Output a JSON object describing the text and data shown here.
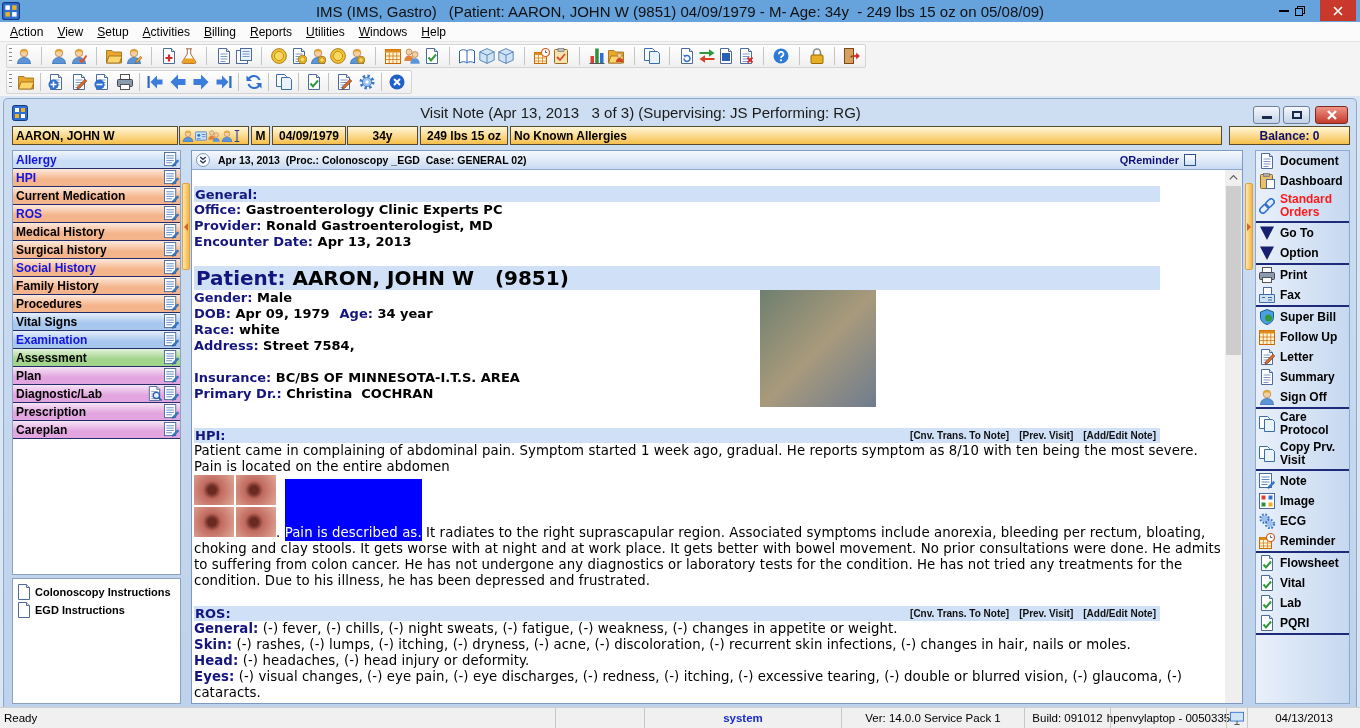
{
  "app": {
    "title": "IMS (IMS, Gastro)",
    "patient_summary": "(Patient: AARON, JOHN W (9851) 04/09/1979 - M- Age: 34y  - 249 lbs 15 oz on 05/08/09)"
  },
  "menu": [
    "Action",
    "View",
    "Setup",
    "Activities",
    "Billing",
    "Reports",
    "Utilities",
    "Windows",
    "Help"
  ],
  "visit_note": {
    "title": "Visit Note (Apr 13, 2013   3 of 3) (Supervising: JS Performing: RG)"
  },
  "patient_bar": {
    "name": "AARON, JOHN W",
    "sex": "M",
    "dob": "04/09/1979",
    "age": "34y",
    "weight": "249 lbs 15 oz",
    "allergies": "No Known Allergies",
    "balance": "Balance: 0"
  },
  "sidebar": {
    "items": [
      {
        "label": "Allergy",
        "kind": "section",
        "color": "#c9ddf6",
        "has_data": true
      },
      {
        "label": "HPI",
        "kind": "section",
        "color": "#f5b58c",
        "has_data": true
      },
      {
        "label": "Current Medication",
        "kind": "section",
        "color": "#f5b58c",
        "has_data": false
      },
      {
        "label": "ROS",
        "kind": "section",
        "color": "#f5b58c",
        "has_data": true
      },
      {
        "label": "Medical History",
        "kind": "section",
        "color": "#f5b58c",
        "has_data": false
      },
      {
        "label": "Surgical history",
        "kind": "section",
        "color": "#f5b58c",
        "has_data": false
      },
      {
        "label": "Social History",
        "kind": "section",
        "color": "#f5b58c",
        "has_data": true
      },
      {
        "label": "Family History",
        "kind": "section",
        "color": "#f5b58c",
        "has_data": false
      },
      {
        "label": "Procedures",
        "kind": "section",
        "color": "#f5b58c",
        "has_data": false
      },
      {
        "label": "Vital Signs",
        "kind": "section",
        "color": "#a8c7ef",
        "has_data": false
      },
      {
        "label": "Examination",
        "kind": "section",
        "color": "#a8c7ef",
        "has_data": true
      },
      {
        "label": "Assessment",
        "kind": "section",
        "color": "#a3d48c",
        "has_data": false
      },
      {
        "label": "Plan",
        "kind": "section",
        "color": "#e2a5df",
        "has_data": false
      },
      {
        "label": "Diagnostic/Lab",
        "kind": "lab",
        "color": "#e2a5df",
        "has_data": false
      },
      {
        "label": "Prescription",
        "kind": "section",
        "color": "#e2a5df",
        "has_data": false
      },
      {
        "label": "Careplan",
        "kind": "section",
        "color": "#e2a5df",
        "has_data": false
      }
    ]
  },
  "documents": [
    "Colonoscopy Instructions",
    "EGD Instructions"
  ],
  "note": {
    "header": {
      "title": "Apr 13, 2013  (Proc.: Colonoscopy _EGD  Case: GENERAL 02)",
      "qreminder": {
        "label": "QReminder",
        "checked": false
      }
    },
    "general": {
      "heading": "General:",
      "fields": [
        {
          "label": "Office:",
          "value": "Gastroenterology Clinic Experts PC"
        },
        {
          "label": "Provider:",
          "value": "Ronald Gastroenterologist, MD"
        },
        {
          "label": "Encounter Date:",
          "value": "Apr 13, 2013"
        }
      ]
    },
    "patient": {
      "label": "Patient:",
      "name": "AARON, JOHN W   (9851)",
      "demographics": [
        [
          {
            "label": "Gender:",
            "value": "Male"
          }
        ],
        [
          {
            "label": "DOB:",
            "value": "Apr 09, 1979"
          },
          {
            "label": "Age:",
            "value": "34 year"
          }
        ],
        [
          {
            "label": "Race:",
            "value": "white"
          }
        ],
        [
          {
            "label": "Address:",
            "value": "Street 7584,"
          }
        ]
      ],
      "coverage": [
        [
          {
            "label": "Insurance:",
            "value": "BC/BS OF MINNESOTA-I.T.S. AREA"
          }
        ],
        [
          {
            "label": "Primary Dr.:",
            "value": "Christina  COCHRAN"
          }
        ]
      ]
    },
    "hpi": {
      "heading": "HPI:",
      "links": [
        "[Cnv. Trans. To Note]",
        "[Prev. Visit]",
        "[Add/Edit Note]"
      ],
      "text": "Patient came in complaining of abdominal pain. Symptom started 1 week ago, gradual. He reports symptom as 8/10 with ten being the most severe. Pain is located on the entire abdomen",
      "after_images": ".",
      "highlight": "Pain is described as.",
      "continuation": "It radiates to the right suprascapular region. Associated symptoms include anorexia, bleeding per rectum, bloating, choking and clay stools. It gets worse with at night and at work place. It gets better with bowel movement. No prior consultations were done. He admits to suffering from colon cancer. He has not undergone any diagnostics or laboratory tests for the condition. He has not tried any treatments for the condition. Due to his illness, he has been depressed and frustrated."
    },
    "ros": {
      "heading": "ROS:",
      "links": [
        "[Cnv. Trans. To Note]",
        "[Prev. Visit]",
        "[Add/Edit Note]"
      ],
      "lines": [
        "**General:** (-) fever, (-) chills, (-) night sweats, (-) fatigue, (-) weakness, (-) changes in appetite or weight.",
        "**Skin:** (-) rashes, (-) lumps, (-) itching, (-) dryness, (-) acne, (-) discoloration, (-) recurrent skin infections, (-) changes in hair, nails or moles.",
        "**Head:** (-) headaches, (-) head injury or deformity.",
        "**Eyes:** (-) visual changes, (-) eye pain, (-) eye discharges, (-) redness, (-) itching, (-) excessive tearing, (-) double or blurred vision, (-) glaucoma, (-) cataracts."
      ]
    }
  },
  "actions": {
    "groups": [
      {
        "items": [
          {
            "label": "Document",
            "alert": false
          },
          {
            "label": "Dashboard",
            "alert": false
          },
          {
            "label": "Standard Orders",
            "alert": true
          }
        ]
      },
      {
        "items": [
          {
            "label": "Go To",
            "alert": false
          },
          {
            "label": "Option",
            "alert": false
          }
        ]
      },
      {
        "items": [
          {
            "label": "Print",
            "alert": false
          },
          {
            "label": "Fax",
            "alert": false
          }
        ]
      },
      {
        "items": [
          {
            "label": "Super Bill",
            "alert": false
          },
          {
            "label": "Follow Up",
            "alert": false
          },
          {
            "label": "Letter",
            "alert": false
          },
          {
            "label": "Summary",
            "alert": false
          },
          {
            "label": "Sign Off",
            "alert": false
          }
        ]
      },
      {
        "items": [
          {
            "label": "Care Protocol",
            "alert": false
          },
          {
            "label": "Copy Prv. Visit",
            "alert": false
          }
        ]
      },
      {
        "items": [
          {
            "label": "Note",
            "alert": false
          },
          {
            "label": "Image",
            "alert": false
          },
          {
            "label": "ECG",
            "alert": false
          },
          {
            "label": "Reminder",
            "alert": false
          }
        ]
      },
      {
        "items": [
          {
            "label": "Flowsheet",
            "alert": false
          },
          {
            "label": "Vital",
            "alert": false
          },
          {
            "label": "Lab",
            "alert": false
          },
          {
            "label": "PQRI",
            "alert": false
          }
        ]
      }
    ]
  },
  "status_bar": {
    "message": "Ready",
    "user": "system",
    "version": "Ver: 14.0.0 Service Pack 1",
    "build": "Build: 091012",
    "machine": "hpenvylaptop - 0050335",
    "date": "04/13/2013"
  }
}
